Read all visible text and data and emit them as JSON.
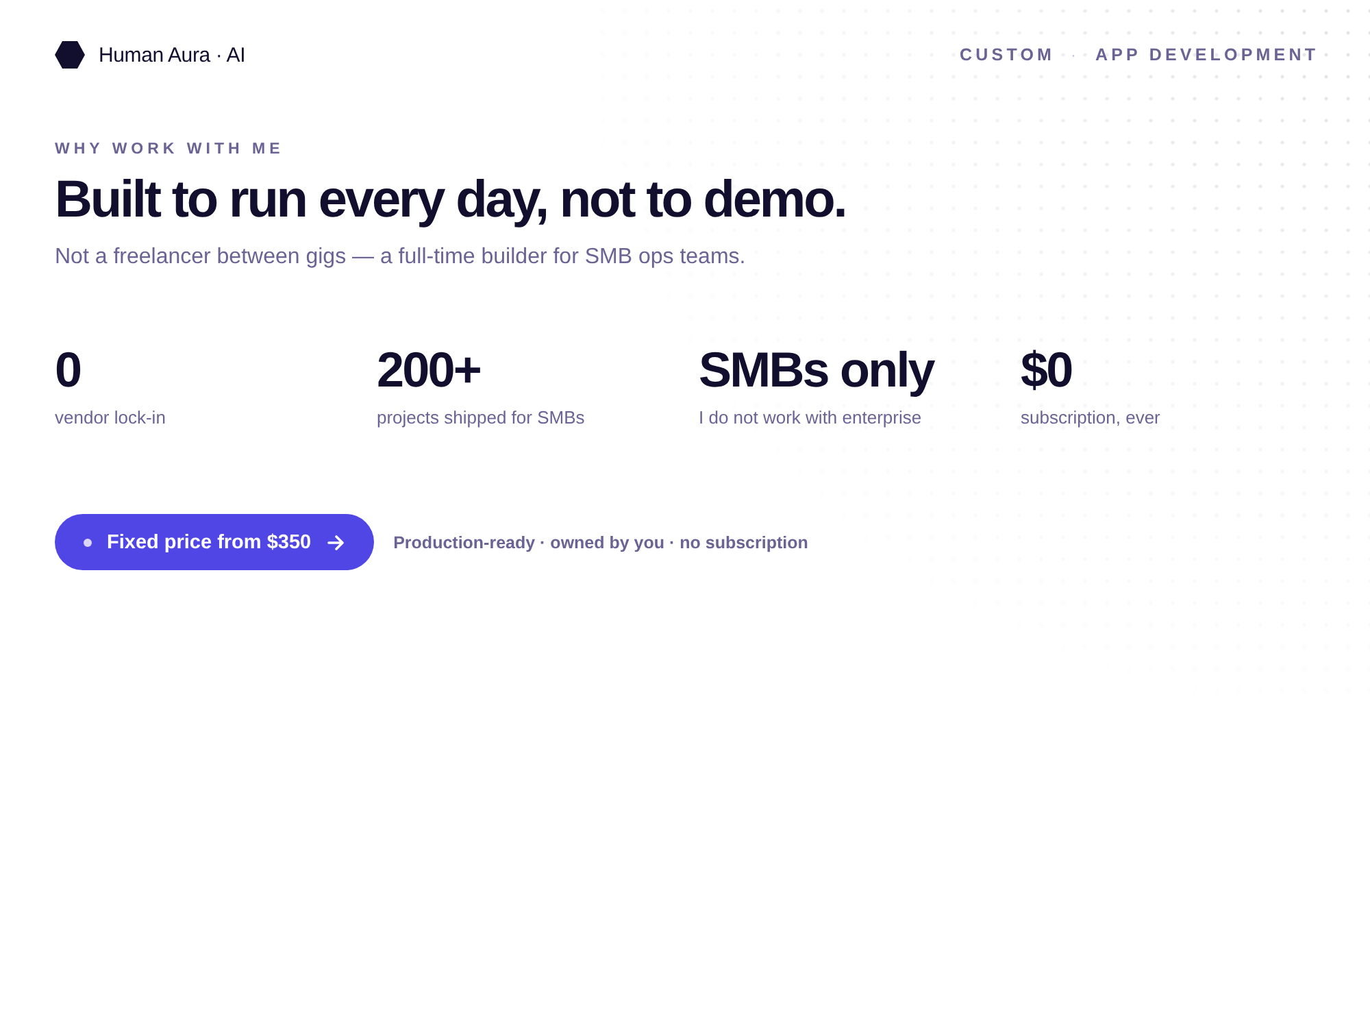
{
  "brand": {
    "name": "Human Aura · AI"
  },
  "nav": {
    "items": [
      "CUSTOM",
      "APP DEVELOPMENT"
    ],
    "separator": "·"
  },
  "hero": {
    "eyebrow": "WHY WORK WITH ME",
    "headline": "Built to run every day, not to demo.",
    "subtitle": "Not a freelancer between gigs — a full-time builder for SMB ops teams."
  },
  "stats": [
    {
      "value": "0",
      "label": "vendor lock-in"
    },
    {
      "value": "200+",
      "label": "projects shipped for SMBs"
    },
    {
      "value": "SMBs only",
      "label": "I do not work with enterprise"
    },
    {
      "value": "$0",
      "label": "subscription, ever"
    }
  ],
  "cta": {
    "button": "Fixed price from $350",
    "note": "Production-ready · owned by you · no subscription"
  }
}
